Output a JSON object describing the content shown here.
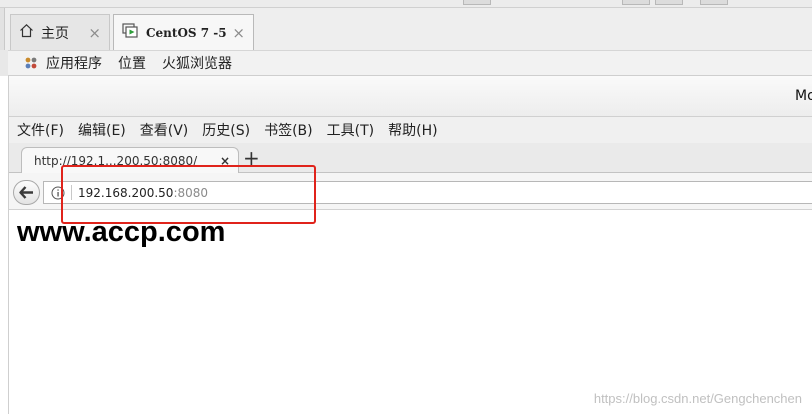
{
  "vm": {
    "tabs": [
      {
        "label": "主页",
        "close": "×"
      },
      {
        "label": "CentOS 7 -5",
        "close": "×"
      }
    ]
  },
  "gnome": {
    "items": [
      "应用程序",
      "位置",
      "火狐浏览器"
    ]
  },
  "firefox": {
    "window_title": "Mozilla Firefox",
    "menu": [
      "文件(F)",
      "编辑(E)",
      "查看(V)",
      "历史(S)",
      "书签(B)",
      "工具(T)",
      "帮助(H)"
    ],
    "tab": {
      "title": "http://192.1...200.50:8080/",
      "close": "×"
    },
    "new_tab": "+",
    "url": {
      "host": "192.168.200.50",
      "port": ":8080"
    }
  },
  "page": {
    "heading": "www.accp.com"
  },
  "watermark": "https://blog.csdn.net/Gengchenchen",
  "colors": {
    "highlight": "#e0231b"
  }
}
